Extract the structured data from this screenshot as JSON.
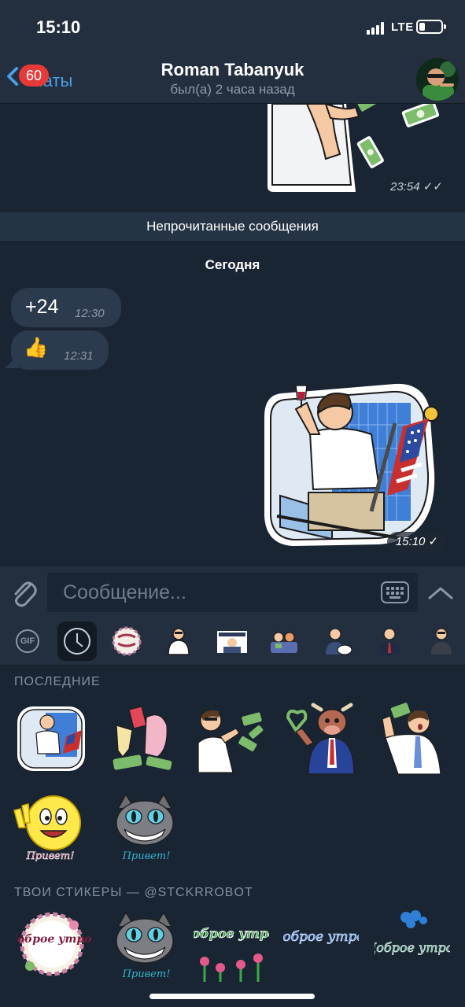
{
  "status": {
    "time": "15:10",
    "network": "LTE",
    "battery_level": 0.25
  },
  "nav": {
    "back_label": "Чаты",
    "unread_badge": "60",
    "title": "Roman Tabanyuk",
    "subtitle": "был(а) 2 часа назад"
  },
  "chat": {
    "prev_sticker_time": "23:54",
    "unread_divider": "Непрочитанные сообщения",
    "date_label": "Сегодня",
    "messages": [
      {
        "text": "+24",
        "time": "12:30",
        "direction": "in"
      },
      {
        "text": "👍",
        "time": "12:31",
        "direction": "in"
      }
    ],
    "last_sticker_time": "15:10"
  },
  "input": {
    "placeholder": "Сообщение..."
  },
  "sticker_tabs": {
    "gif_label": "GIF",
    "items": [
      "recent",
      "dobroe-utro-pack",
      "pack-2",
      "pack-3",
      "pack-4",
      "pack-5",
      "pack-6",
      "pack-7"
    ]
  },
  "sticker_panel": {
    "recent_title": "ПОСЛЕДНИЕ",
    "pack_title": "ТВОИ СТИКЕРЫ — @STCKRROBOT",
    "recent_stickers": [
      "man-with-wine-flag",
      "champagne-party",
      "man-with-money",
      "bull-in-suit",
      "man-with-dollar",
      "smiley-victory",
      "cheshire-cat"
    ],
    "pack_stickers": [
      "dobroe-utro-wreath",
      "cheshire-cat-privet",
      "dobroe-utro-green",
      "dobroe-utro-blue",
      "dobroe-utro-flowers"
    ],
    "privet_caption": "Привет!",
    "dobroe_caption": "Доброе утро!"
  },
  "colors": {
    "background": "#1a2533",
    "bar": "#232f3e",
    "accent": "#4aa0e6",
    "badge": "#e5393a",
    "bubble_in": "#2b3a4c"
  }
}
